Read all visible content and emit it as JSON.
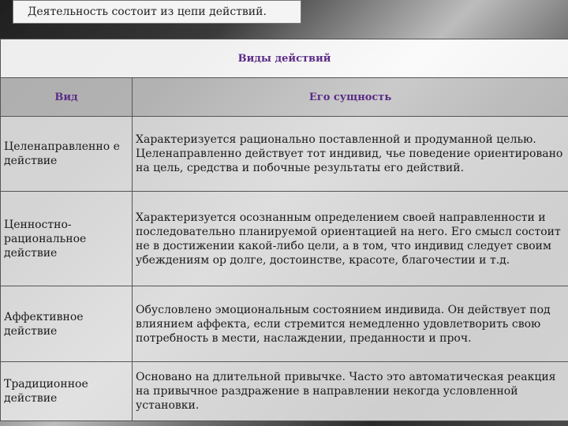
{
  "slide": {
    "title": "Деятельность состоит из цепи действий."
  },
  "table": {
    "caption": "Виды действий",
    "col_kind": "Вид",
    "col_essence": "Его сущность",
    "rows": [
      {
        "kind": "Целенаправленно е действие",
        "essence": "Характеризуется рационально поставленной и продуманной целью. Целенаправленно действует тот индивид, чье поведение ориентировано на цель, средства и побочные результаты его действий."
      },
      {
        "kind": "Ценностно-рациональное действие",
        "essence": "Характеризуется осознанным определением своей направленности и последовательно планируемой ориентацией на него. Его смысл состоит не в достижении какой-либо цели, а в том, что индивид следует своим убеждениям ор долге, достоинстве, красоте, благочестии и т.д."
      },
      {
        "kind": "Аффективное действие",
        "essence": "Обусловлено эмоциональным состоянием индивида. Он действует под влиянием аффекта, если стремится немедленно удовлетворить свою потребность в мести, наслаждении, преданности и проч."
      },
      {
        "kind": "Традиционное действие",
        "essence": "Основано на длительной привычке. Часто это автоматическая реакция на привычное раздражение в направлении некогда условленной установки."
      }
    ]
  }
}
